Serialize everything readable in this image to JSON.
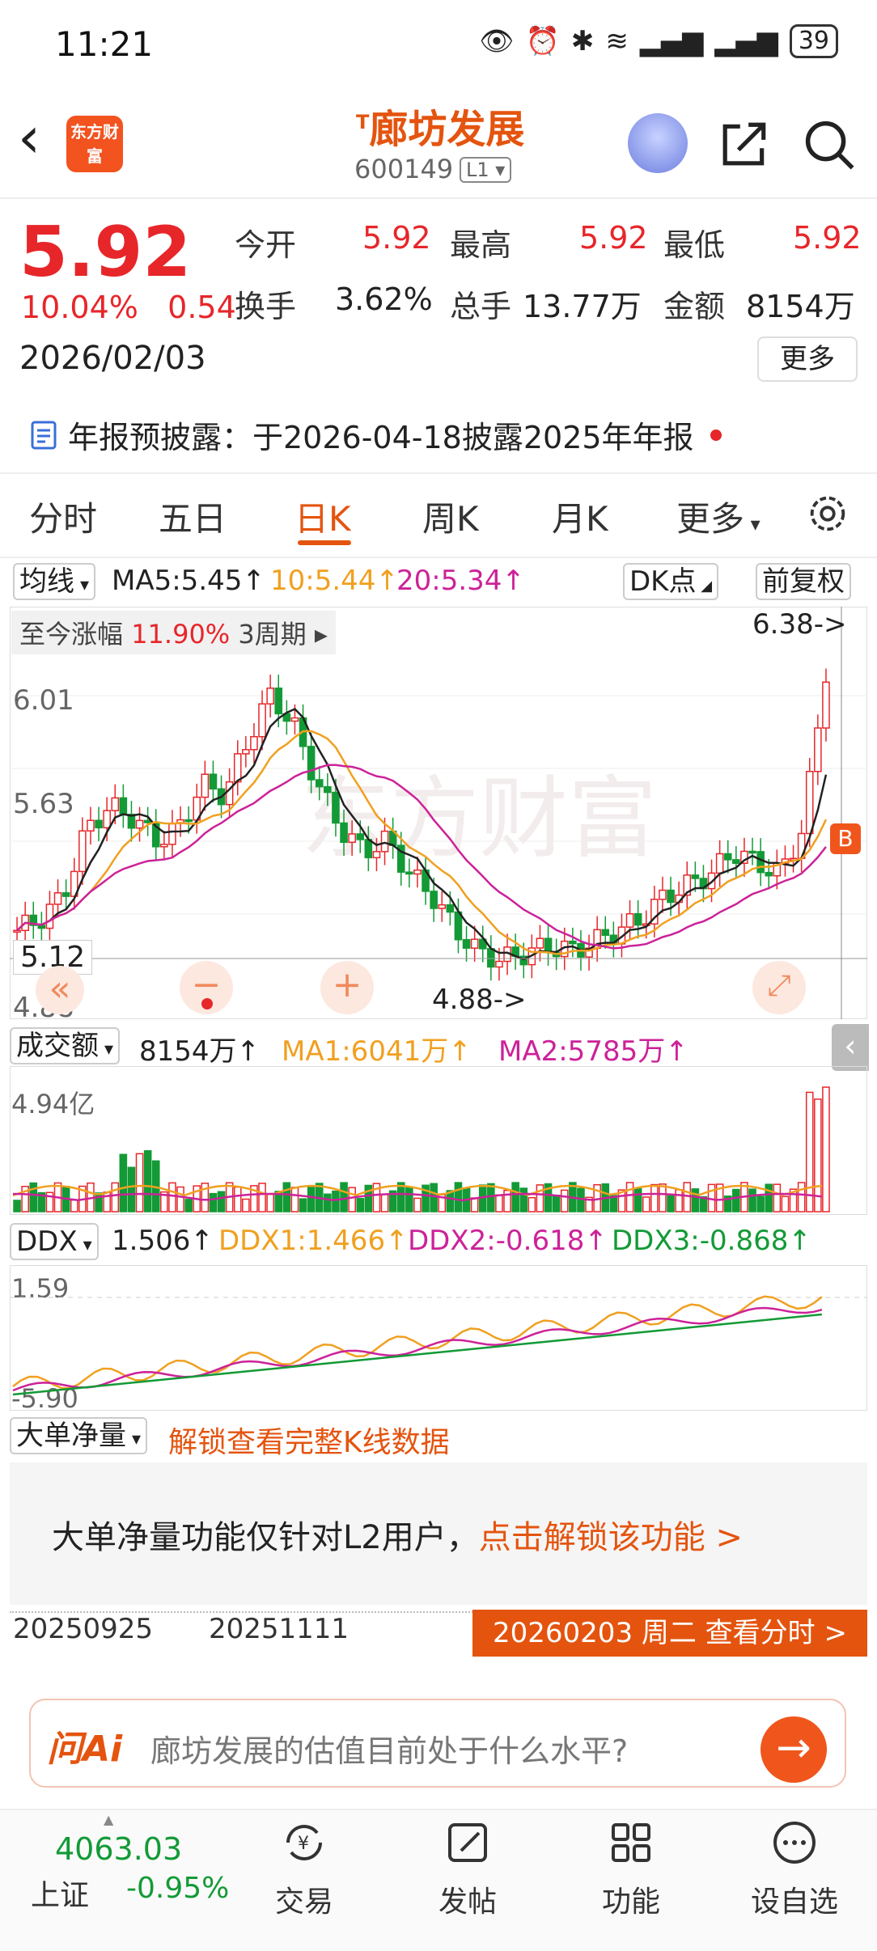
{
  "status": {
    "time": "11:21",
    "battery": "39"
  },
  "header": {
    "title_prefix": "T",
    "title": "廊坊发展",
    "code": "600149",
    "level": "L1"
  },
  "logo_text": "东方财富",
  "quote": {
    "price": "5.92",
    "change_pct": "10.04%",
    "change": "0.54",
    "date": "2026/02/03",
    "open_label": "今开",
    "open": "5.92",
    "high_label": "最高",
    "high": "5.92",
    "low_label": "最低",
    "low": "5.92",
    "turnover_label": "换手",
    "turnover": "3.62%",
    "volume_label": "总手",
    "volume": "13.77万",
    "amount_label": "金额",
    "amount": "8154万",
    "more": "更多"
  },
  "notice": "年报预披露：于2026-04-18披露2025年年报",
  "tabs": [
    "分时",
    "五日",
    "日K",
    "周K",
    "月K",
    "更多"
  ],
  "active_tab": "日K",
  "indicators": {
    "ma_select": "均线",
    "ma5": "MA5:5.45↑",
    "ma10": "10:5.44↑",
    "ma20": "20:5.34↑",
    "dk": "DK点",
    "fq": "前复权",
    "zj_label": "至今涨幅",
    "zj_value": "11.90%",
    "zj_period": "3周期",
    "hi_note": "6.38->",
    "lo_note": "4.88->",
    "y_ticks": [
      "6.01",
      "5.63",
      "5.12",
      "4.88"
    ],
    "b_mark": "B"
  },
  "volume": {
    "select": "成交额",
    "value": "8154万↑",
    "ma1": "MA1:6041万↑",
    "ma2": "MA2:5785万↑",
    "max_label": "4.94亿"
  },
  "ddx": {
    "select": "DDX",
    "value": "1.506↑",
    "ddx1": "DDX1:1.466↑",
    "ddx2": "DDX2:-0.618↑",
    "ddx3": "DDX3:-0.868↑",
    "top_label": "1.59",
    "bottom_label": "-5.90"
  },
  "bigorder": {
    "select": "大单净量",
    "unlock_link": "解锁查看完整K线数据",
    "panel_text": "大单净量功能仅针对L2用户，",
    "panel_link": "点击解锁该功能 >"
  },
  "date_axis": {
    "start": "20250925",
    "mid": "20251111",
    "current": "20260203 周二 查看分时 >"
  },
  "ask": {
    "logo": "问Ai",
    "placeholder": "廊坊发展的估值目前处于什么水平?"
  },
  "bottom": {
    "index_value": "4063.03",
    "index_name": "上证",
    "index_change": "-0.95%",
    "nav": [
      "交易",
      "发帖",
      "功能",
      "设自选"
    ]
  },
  "colors": {
    "up": "#e7262a",
    "down": "#139a36",
    "accent": "#e4540f",
    "ma5": "#222222",
    "ma10": "#f0a020",
    "ma20": "#cc2299"
  }
}
